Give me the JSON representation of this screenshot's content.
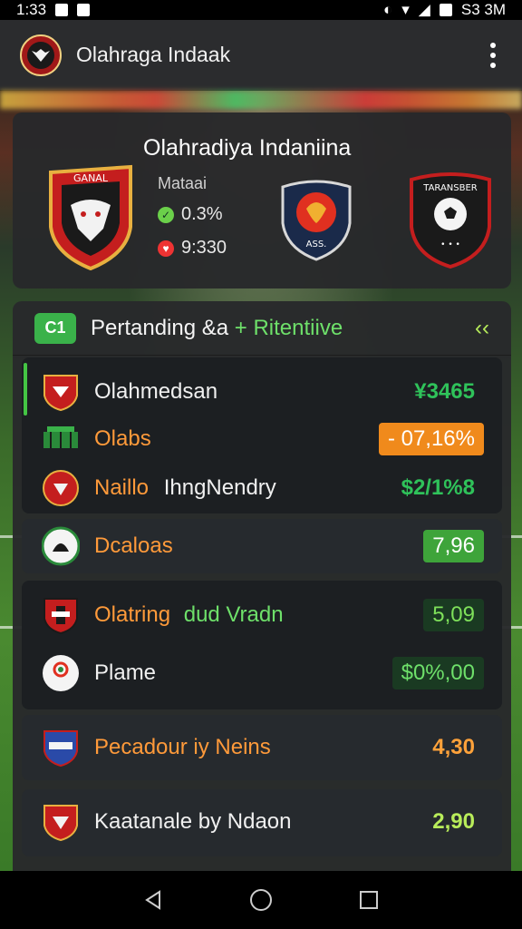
{
  "status": {
    "time": "1:33",
    "clock_right": "S3 3M"
  },
  "app": {
    "title": "Olahraga Indaak"
  },
  "match": {
    "title": "Olahradiya Indaniina",
    "label": "Mataai",
    "stat1": "0.3%",
    "stat2": "9:330",
    "home_crest_text": "GANAL",
    "away_crest_text": "TARANSBER",
    "mid_crest_text": "ASS."
  },
  "list": {
    "header_badge": "C1",
    "header_title": "Pertanding &a",
    "header_accent": "+ Ritentiive",
    "rows": [
      {
        "label": "Olahmedsan",
        "value": "¥3465"
      },
      {
        "label": "Olabs",
        "value": "- 07,16%"
      },
      {
        "label_a": "Naillo",
        "label_b": "IhngNendry",
        "value": "$2/1%8"
      },
      {
        "label": "Dcaloas",
        "value": "7,96"
      },
      {
        "label_a": "Olatring",
        "label_b": "dud Vradn",
        "value": "5,09"
      },
      {
        "label": "Plame",
        "value": "$0%,00"
      },
      {
        "label": "Pecadour iy Neins",
        "value": "4,30"
      },
      {
        "label": "Kaatanale by Ndaon",
        "value": "2,90"
      }
    ]
  },
  "colors": {
    "accent_green": "#6ee06a",
    "accent_orange": "#ff9a3a",
    "panel": "#28292b"
  }
}
